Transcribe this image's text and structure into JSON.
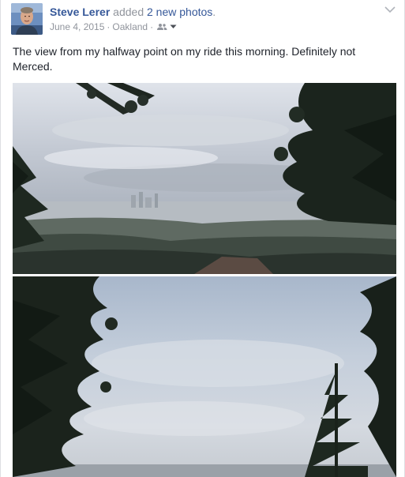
{
  "post": {
    "author": "Steve Lerer",
    "action_text": "added",
    "photos_link": "2 new photos",
    "period": ".",
    "date": "June 4, 2015",
    "location": "Oakland",
    "separator": "·",
    "audience_icon": "friends-icon",
    "menu_icon": "chevron-down-icon",
    "text": "The view from my halfway point on my ride this morning. Definitely not Merced.",
    "photos": [
      {
        "alt": "photo-city-view-overcast"
      },
      {
        "alt": "photo-sky-trees-overcast"
      }
    ]
  },
  "colors": {
    "link": "#365899",
    "meta": "#90949c",
    "text": "#1d2129",
    "border": "#dddfe2"
  }
}
